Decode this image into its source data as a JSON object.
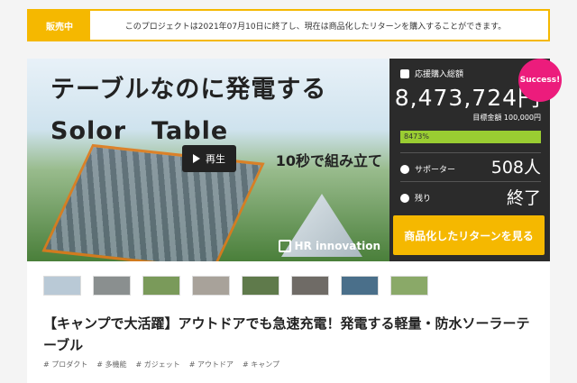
{
  "notice": {
    "badge": "販売中",
    "text": "このプロジェクトは2021年07月10日に終了し、現在は商品化したリターンを購入することができます。"
  },
  "hero": {
    "title": "テーブルなのに発電する",
    "subtitle": "Solor　Table",
    "tagline": "10秒で組み立て",
    "brand": "HR innovation",
    "play_label": "再生"
  },
  "stats": {
    "funding_label": "応援購入総額",
    "amount": "8,473,724円",
    "goal": "目標金額 100,000円",
    "progress_text": "8473%",
    "progress": 1.0,
    "supporters_label": "サポーター",
    "supporters": "508人",
    "remaining_label": "残り",
    "remaining": "終了",
    "success_badge": "Success!"
  },
  "cta": {
    "label": "商品化したリターンを見る"
  },
  "thumbnails": [
    {
      "color": "#b9c9d6"
    },
    {
      "color": "#8a8f8f"
    },
    {
      "color": "#7a9a5a"
    },
    {
      "color": "#a8a29a"
    },
    {
      "color": "#5f7a4b"
    },
    {
      "color": "#6f6b66"
    },
    {
      "color": "#4a6f8a"
    },
    {
      "color": "#8aa968"
    }
  ],
  "project": {
    "title": "【キャンプで大活躍】アウトドアでも急速充電！発電する軽量・防水ソーラーテーブル"
  },
  "tags": [
    "# プロダクト",
    "# 多機能",
    "# ガジェット",
    "# アウトドア",
    "# キャンプ"
  ]
}
